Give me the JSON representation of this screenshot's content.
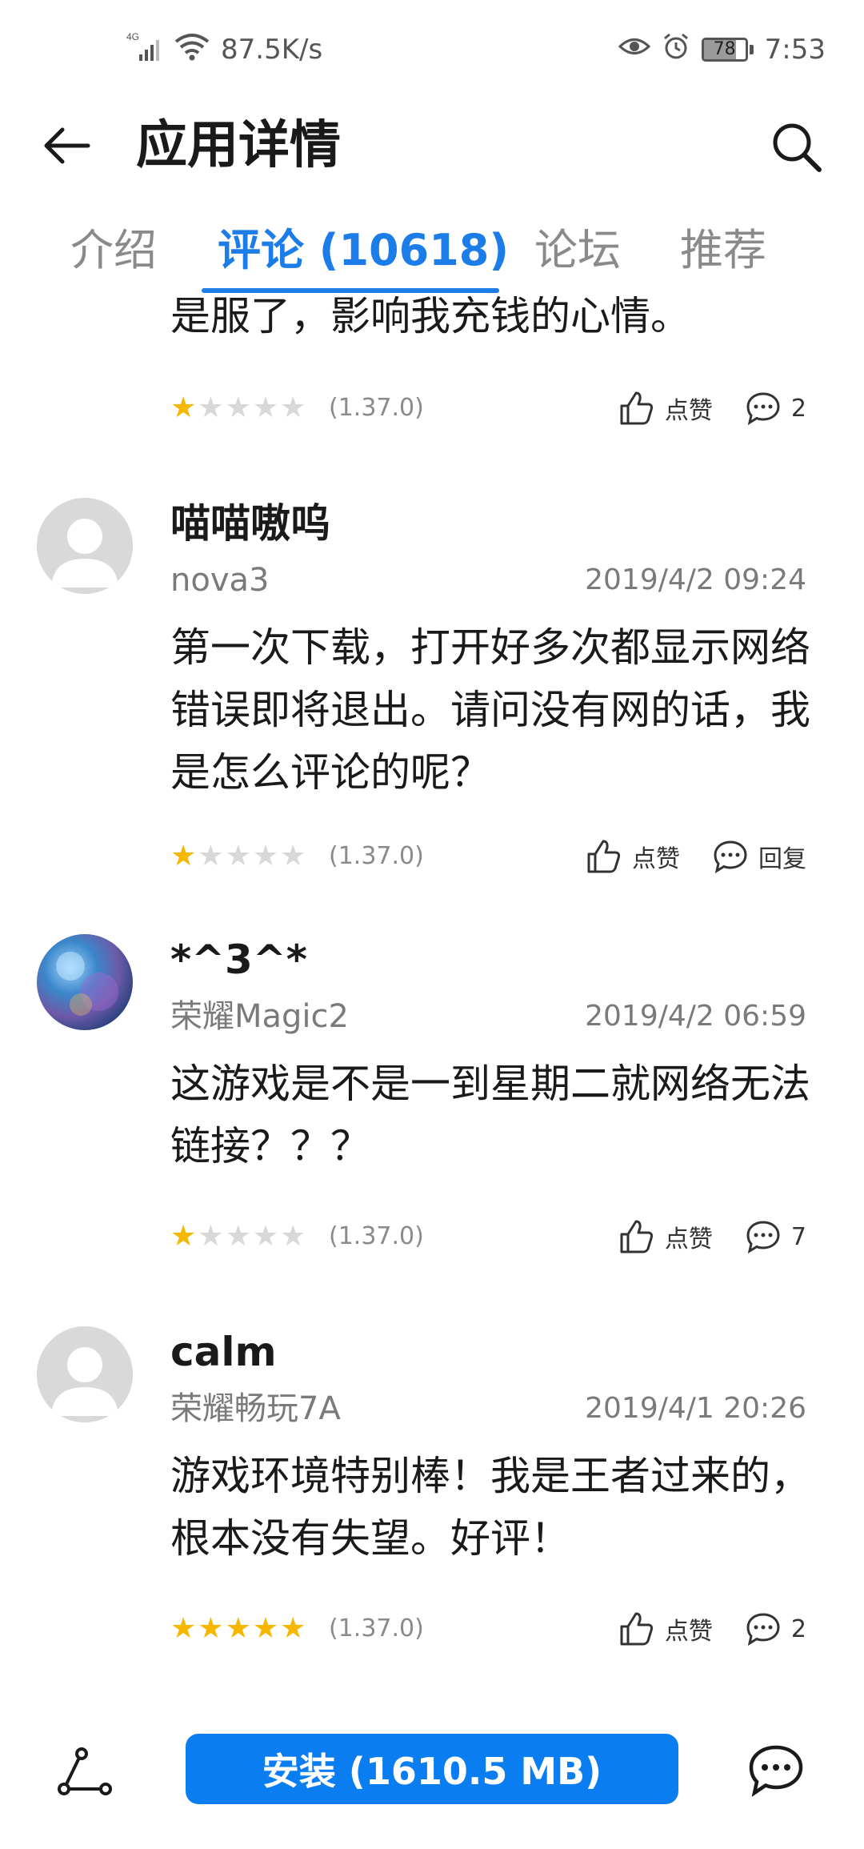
{
  "status_bar": {
    "network": "4G",
    "speed": "87.5K/s",
    "battery": "78",
    "battery_level": 0.78,
    "time": "7:53"
  },
  "header": {
    "title": "应用详情",
    "back_icon": "arrow-left-icon",
    "search_icon": "search-icon"
  },
  "tabs": [
    {
      "label": "介绍",
      "active": false
    },
    {
      "label": "评论 (10618)",
      "active": true
    },
    {
      "label": "论坛",
      "active": false
    },
    {
      "label": "推荐",
      "active": false
    }
  ],
  "reviews": [
    {
      "text": "是服了，影响我充钱的心情。",
      "rating": 1,
      "version": "(1.37.0)",
      "like_label": "点赞",
      "reply_label": "2"
    },
    {
      "username": "喵喵嗷呜",
      "device": "nova3",
      "datetime": "2019/4/2 09:24",
      "text": "第一次下载，打开好多次都显示网络错误即将退出。请问没有网的话，我是怎么评论的呢？",
      "rating": 1,
      "version": "(1.37.0)",
      "like_label": "点赞",
      "reply_label": "回复",
      "avatar": "default-avatar"
    },
    {
      "username": "*^3^*",
      "device": "荣耀Magic2",
      "datetime": "2019/4/2 06:59",
      "text": "这游戏是不是一到星期二就网络无法链接？？？",
      "rating": 1,
      "version": "(1.37.0)",
      "like_label": "点赞",
      "reply_label": "7",
      "avatar": "photo-avatar"
    },
    {
      "username": "calm",
      "device": "荣耀畅玩7A",
      "datetime": "2019/4/1 20:26",
      "text": "游戏环境特别棒！我是王者过来的，根本没有失望。好评！",
      "rating": 5,
      "version": "(1.37.0)",
      "like_label": "点赞",
      "reply_label": "2",
      "avatar": "default-avatar"
    }
  ],
  "bottom_bar": {
    "install_label": "安装 (1610.5 MB)",
    "share_icon": "share-icon",
    "chat_icon": "chat-icon"
  },
  "colors": {
    "accent": "#1c7ce8",
    "install_button": "#0a7df1",
    "star_on": "#f5b700",
    "star_off": "#d8d8d8"
  }
}
